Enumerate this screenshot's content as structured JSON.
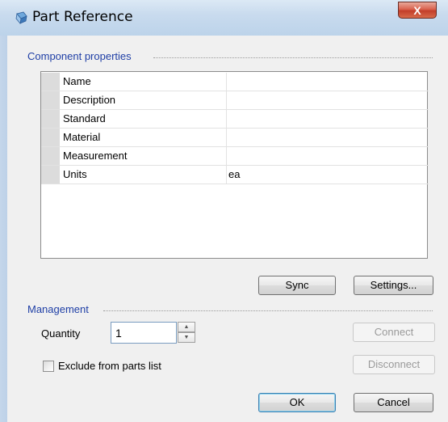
{
  "window": {
    "title": "Part Reference"
  },
  "icons": {
    "app": "part-reference-icon",
    "close": "close-icon"
  },
  "component": {
    "section_label": "Component properties",
    "rows": [
      {
        "name": "Name",
        "value": ""
      },
      {
        "name": "Description",
        "value": ""
      },
      {
        "name": "Standard",
        "value": ""
      },
      {
        "name": "Material",
        "value": ""
      },
      {
        "name": "Measurement",
        "value": ""
      },
      {
        "name": "Units",
        "value": "ea"
      }
    ],
    "sync_label": "Sync",
    "settings_label": "Settings..."
  },
  "management": {
    "section_label": "Management",
    "quantity_label": "Quantity",
    "quantity_value": "1",
    "connect_label": "Connect",
    "disconnect_label": "Disconnect",
    "exclude_label": "Exclude from parts list",
    "exclude_checked": false
  },
  "footer": {
    "ok_label": "OK",
    "cancel_label": "Cancel"
  },
  "colors": {
    "section_label": "#1f3fa6",
    "close_button": "#c23e2a"
  }
}
